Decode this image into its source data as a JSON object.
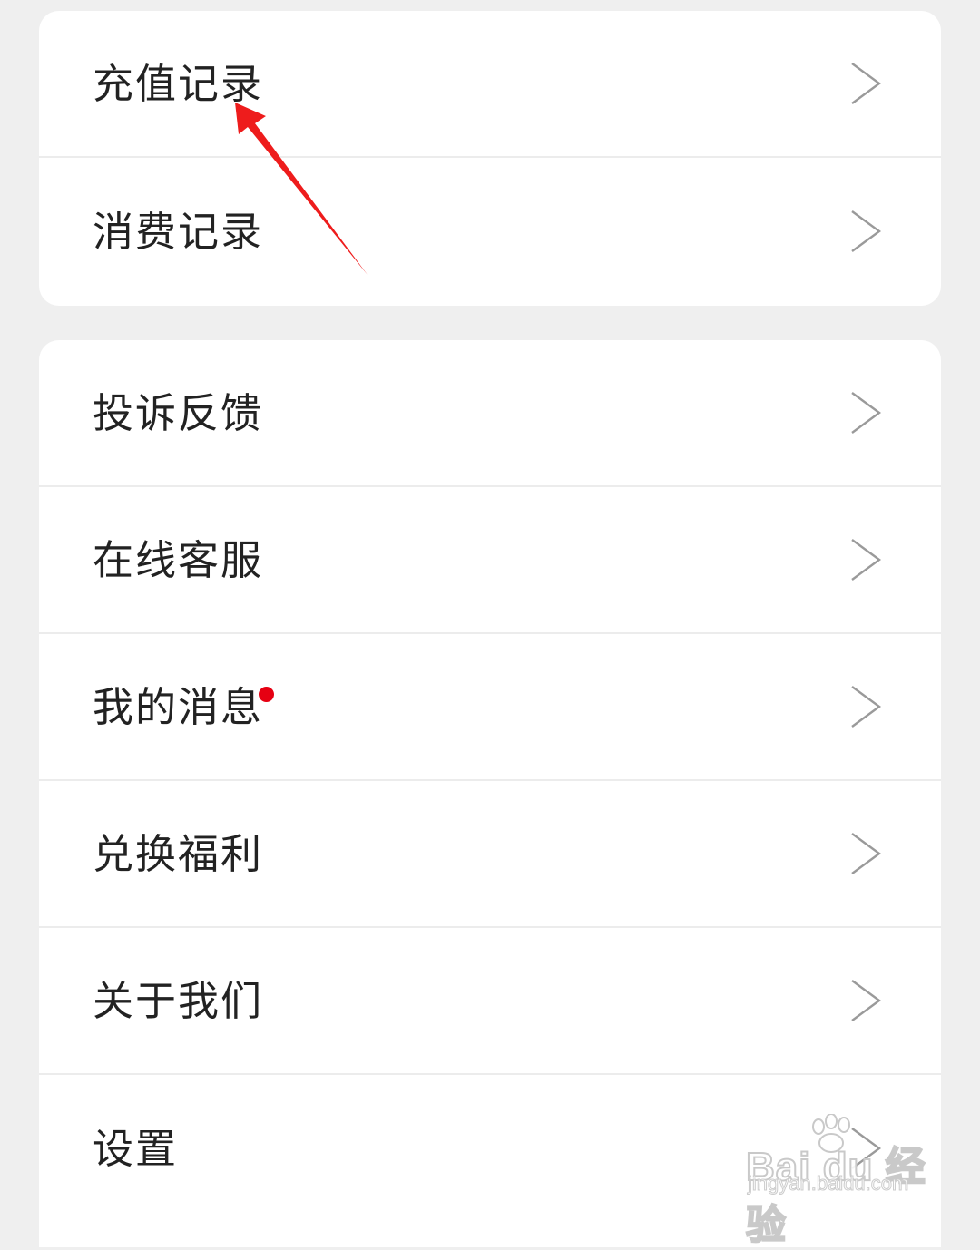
{
  "top_group": {
    "items": [
      {
        "label": "充值记录"
      },
      {
        "label": "消费记录"
      }
    ]
  },
  "bottom_group": {
    "items": [
      {
        "label": "投诉反馈"
      },
      {
        "label": "在线客服"
      },
      {
        "label": "我的消息",
        "has_unread": true
      },
      {
        "label": "兑换福利"
      },
      {
        "label": "关于我们"
      },
      {
        "label": "设置"
      }
    ]
  },
  "icons": {
    "row_chevron": "chevron-right-icon",
    "unread_badge": "red-dot-badge"
  },
  "annotation": {
    "type": "red-arrow",
    "color": "#ee1c1c",
    "target": "充值记录"
  },
  "watermark": {
    "brand": "Bai du 经验",
    "url": "jingyan.baidu.com"
  },
  "colors": {
    "background": "#efefef",
    "card": "#ffffff",
    "text": "#222222",
    "divider": "#ececec",
    "chevron": "#9a9a9a",
    "badge": "#e60012"
  }
}
